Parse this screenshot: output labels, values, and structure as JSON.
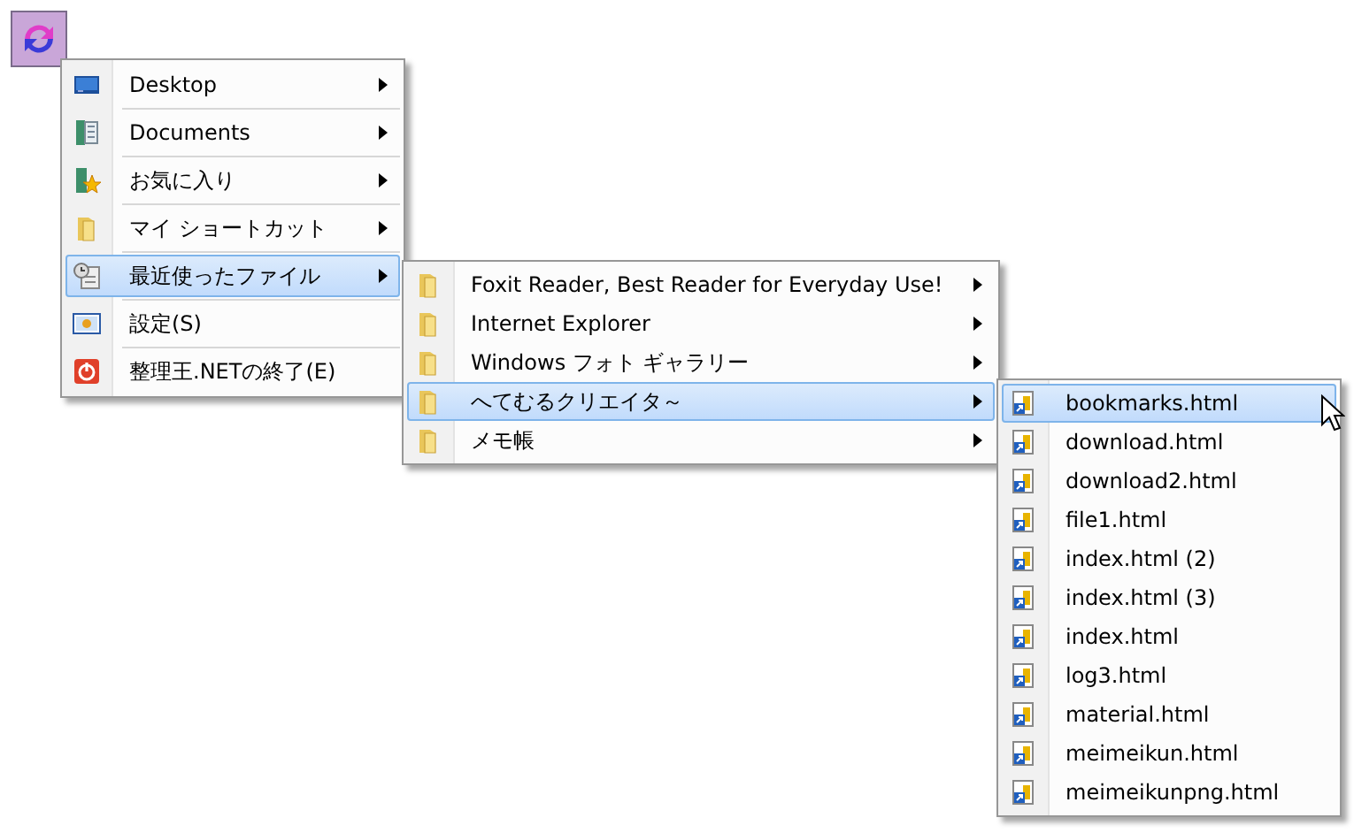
{
  "menus": [
    {
      "separators": true,
      "items": [
        {
          "kind": "desktop",
          "label": "Desktop",
          "submenu": true,
          "selected": false
        },
        {
          "kind": "documents",
          "label": "Documents",
          "submenu": true,
          "selected": false
        },
        {
          "kind": "favorites",
          "label": "お気に入り",
          "submenu": true,
          "selected": false
        },
        {
          "kind": "folder",
          "label": "マイ ショートカット",
          "submenu": true,
          "selected": false
        },
        {
          "kind": "recent",
          "label": "最近使ったファイル",
          "submenu": true,
          "selected": true
        },
        {
          "kind": "settings",
          "label": "設定(S)",
          "submenu": false,
          "selected": false
        },
        {
          "kind": "exit",
          "label": "整理王.NETの終了(E)",
          "submenu": false,
          "selected": false
        }
      ]
    },
    {
      "separators": false,
      "items": [
        {
          "kind": "folder",
          "label": "Foxit Reader, Best Reader for Everyday Use!",
          "submenu": true,
          "selected": false
        },
        {
          "kind": "folder",
          "label": "Internet Explorer",
          "submenu": true,
          "selected": false
        },
        {
          "kind": "folder",
          "label": "Windows フォト ギャラリー",
          "submenu": true,
          "selected": false
        },
        {
          "kind": "folder",
          "label": "へてむるクリエイタ～",
          "submenu": true,
          "selected": true
        },
        {
          "kind": "folder",
          "label": "メモ帳",
          "submenu": true,
          "selected": false
        }
      ]
    },
    {
      "separators": false,
      "items": [
        {
          "kind": "file",
          "label": "bookmarks.html",
          "submenu": false,
          "selected": true
        },
        {
          "kind": "file",
          "label": "download.html",
          "submenu": false,
          "selected": false
        },
        {
          "kind": "file",
          "label": "download2.html",
          "submenu": false,
          "selected": false
        },
        {
          "kind": "file",
          "label": "file1.html",
          "submenu": false,
          "selected": false
        },
        {
          "kind": "file",
          "label": "index.html (2)",
          "submenu": false,
          "selected": false
        },
        {
          "kind": "file",
          "label": "index.html (3)",
          "submenu": false,
          "selected": false
        },
        {
          "kind": "file",
          "label": "index.html",
          "submenu": false,
          "selected": false
        },
        {
          "kind": "file",
          "label": "log3.html",
          "submenu": false,
          "selected": false
        },
        {
          "kind": "file",
          "label": "material.html",
          "submenu": false,
          "selected": false
        },
        {
          "kind": "file",
          "label": "meimeikun.html",
          "submenu": false,
          "selected": false
        },
        {
          "kind": "file",
          "label": "meimeikunpng.html",
          "submenu": false,
          "selected": false
        }
      ]
    }
  ]
}
